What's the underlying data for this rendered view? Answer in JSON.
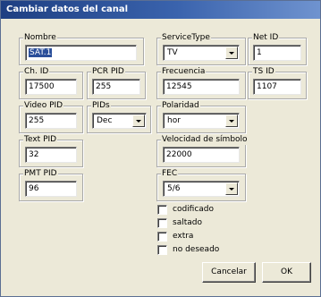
{
  "window": {
    "title": "Cambiar datos del canal"
  },
  "fields": {
    "nombre": {
      "label": "Nombre",
      "value": "SAT.1"
    },
    "service_type": {
      "label": "ServiceType",
      "value": "TV"
    },
    "net_id": {
      "label": "Net ID",
      "value": "1"
    },
    "ch_id": {
      "label": "Ch. ID",
      "value": "17500"
    },
    "pcr_pid": {
      "label": "PCR PID",
      "value": "255"
    },
    "frecuencia": {
      "label": "Frecuencia",
      "value": "12545"
    },
    "ts_id": {
      "label": "TS ID",
      "value": "1107"
    },
    "video_pid": {
      "label": "Video PID",
      "value": "255"
    },
    "pids": {
      "label": "PIDs",
      "value": "Dec"
    },
    "polaridad": {
      "label": "Polaridad",
      "value": "hor"
    },
    "text_pid": {
      "label": "Text PID",
      "value": "32"
    },
    "velocidad": {
      "label": "Velocidad de símbolo",
      "value": "22000"
    },
    "pmt_pid": {
      "label": "PMT PID",
      "value": "96"
    },
    "fec": {
      "label": "FEC",
      "value": "5/6"
    }
  },
  "checkboxes": [
    {
      "label": "codificado",
      "checked": false
    },
    {
      "label": "saltado",
      "checked": false
    },
    {
      "label": "extra",
      "checked": false
    },
    {
      "label": "no deseado",
      "checked": false
    }
  ],
  "buttons": {
    "cancel": "Cancelar",
    "ok": "OK"
  }
}
